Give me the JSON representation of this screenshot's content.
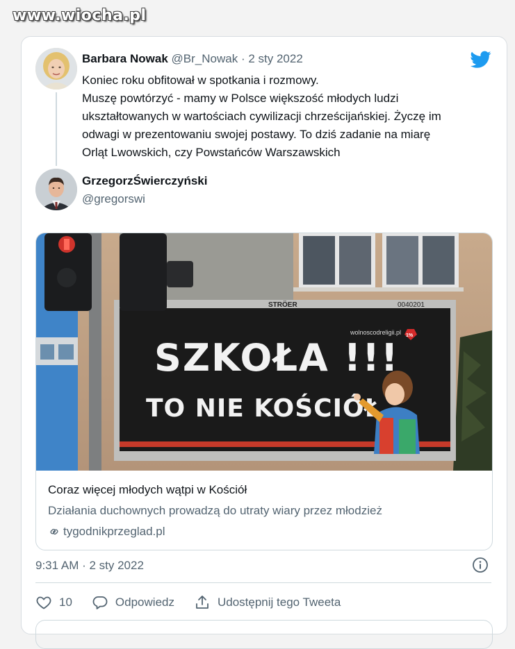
{
  "watermark": "www.wiocha.pl",
  "tweet": {
    "author_name": "Barbara Nowak",
    "author_handle": "@Br_Nowak",
    "separator": "·",
    "date": "2 sty 2022",
    "lines": [
      "Koniec roku obfitował w spotkania i rozmowy.",
      "Muszę powtórzyć - mamy w Polsce większość młodych ludzi",
      "ukształtowanych w wartościach cywilizacji chrześcijańskiej. Życzę im",
      "odwagi w prezentowaniu swojej postawy. To dziś zadanie na miarę",
      "Orląt Lwowskich, czy Powstańców Warszawskich"
    ]
  },
  "reply": {
    "author_name": "GrzegorzŚwierczyński",
    "author_handle": "@gregorswi"
  },
  "link_card": {
    "title": "Coraz więcej młodych wątpi w Kościół",
    "description": "Działania duchownych prowadzą do utraty wiary przez młodzież",
    "domain": "tygodnikprzeglad.pl",
    "billboard": {
      "brand": "STRÖER",
      "number": "0040201",
      "line1": "SZKOŁA !!!",
      "line2": "TO NIE KOŚCIÓŁ",
      "site": "wolnoscodreligii.pl",
      "badge": "1%"
    }
  },
  "timestamp": "9:31 AM · 2 sty 2022",
  "actions": {
    "likes": "10",
    "reply_label": "Odpowiedz",
    "share_label": "Udostępnij tego Tweeta"
  },
  "colors": {
    "accent": "#1d9bf0",
    "muted": "#536471",
    "border": "#cfd9de",
    "billboard_bg": "#1a1a1a"
  },
  "icons": [
    "twitter-bird-icon",
    "info-icon",
    "heart-icon",
    "reply-icon",
    "share-icon",
    "link-icon"
  ]
}
